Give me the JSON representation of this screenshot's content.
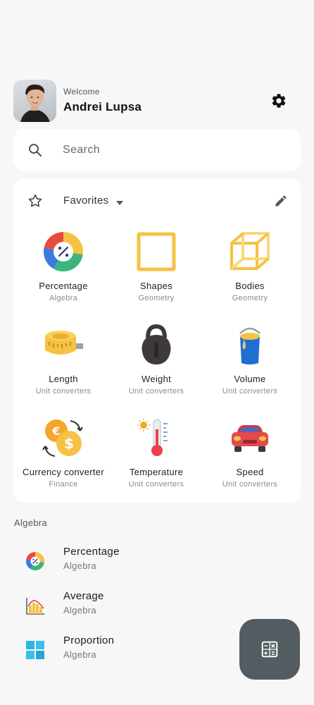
{
  "header": {
    "welcome": "Welcome",
    "user_name": "Andrei Lupsa",
    "settings_icon": "gear-icon"
  },
  "search": {
    "placeholder": "Search",
    "icon": "search-icon"
  },
  "favorites": {
    "title": "Favorites",
    "star_icon": "star-outline-icon",
    "dropdown_icon": "caret-down-icon",
    "edit_icon": "pencil-icon",
    "items": [
      {
        "label": "Percentage",
        "category": "Algebra",
        "icon": "percentage-icon"
      },
      {
        "label": "Shapes",
        "category": "Geometry",
        "icon": "square-shape-icon"
      },
      {
        "label": "Bodies",
        "category": "Geometry",
        "icon": "cube-icon"
      },
      {
        "label": "Length",
        "category": "Unit converters",
        "icon": "tape-measure-icon"
      },
      {
        "label": "Weight",
        "category": "Unit converters",
        "icon": "kettlebell-icon"
      },
      {
        "label": "Volume",
        "category": "Unit converters",
        "icon": "paint-bucket-icon"
      },
      {
        "label": "Currency converter",
        "category": "Finance",
        "icon": "currency-exchange-icon"
      },
      {
        "label": "Temperature",
        "category": "Unit converters",
        "icon": "thermometer-icon"
      },
      {
        "label": "Speed",
        "category": "Unit converters",
        "icon": "car-icon"
      }
    ]
  },
  "algebra_section": {
    "title": "Algebra",
    "items": [
      {
        "label": "Percentage",
        "category": "Algebra",
        "icon": "percentage-icon"
      },
      {
        "label": "Average",
        "category": "Algebra",
        "icon": "bar-chart-icon"
      },
      {
        "label": "Proportion",
        "category": "Algebra",
        "icon": "tiles-icon"
      }
    ]
  },
  "fab": {
    "icon": "calculator-icon"
  },
  "colors": {
    "background": "#f7f7f7",
    "card": "#ffffff",
    "fab": "#535c61",
    "accent_yellow": "#f6c243",
    "accent_red": "#e94b3c",
    "accent_blue": "#3b7be0",
    "accent_green": "#3bb57b"
  }
}
